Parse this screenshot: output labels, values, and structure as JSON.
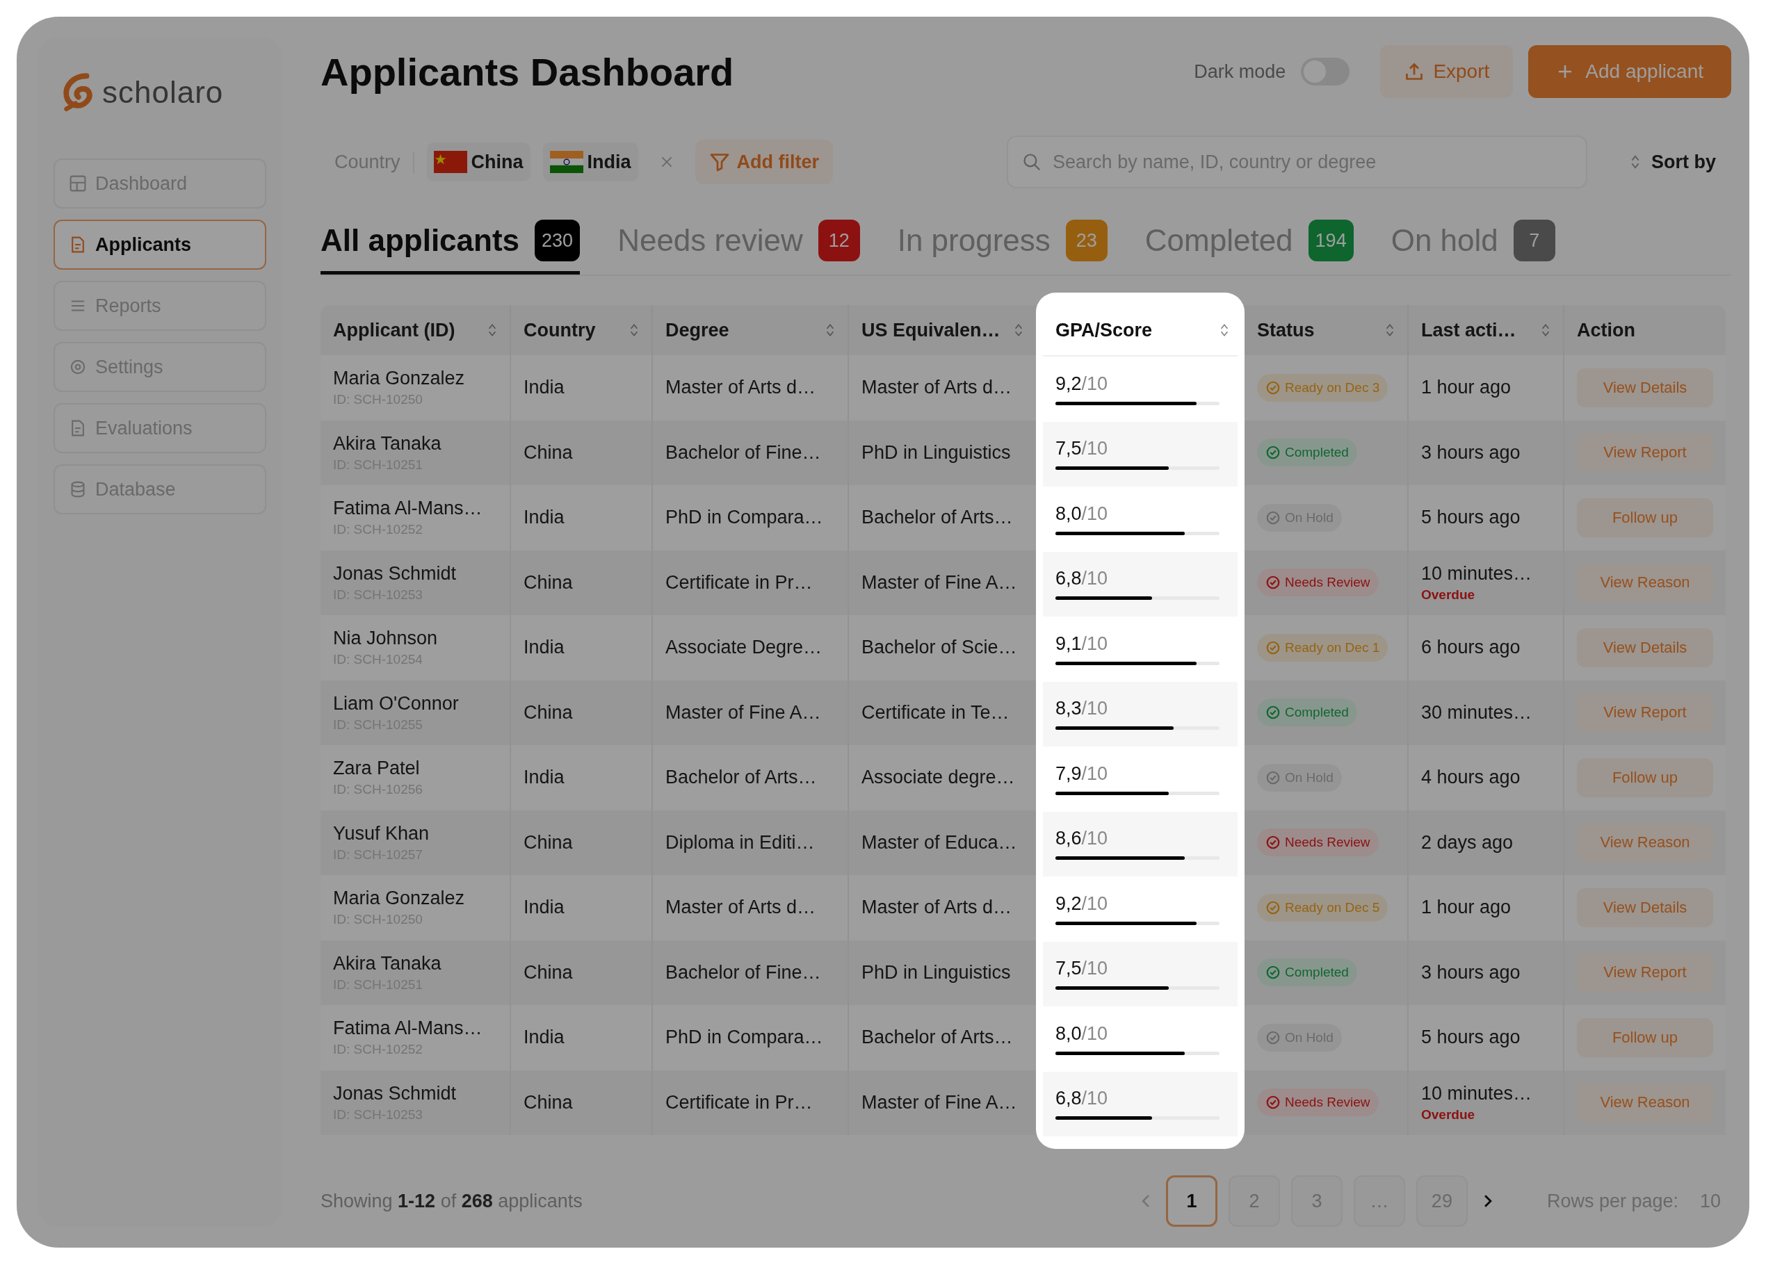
{
  "sidebar": {
    "logo": "scholaro",
    "items": [
      {
        "label": "Dashboard",
        "selected": false
      },
      {
        "label": "Applicants",
        "selected": true
      },
      {
        "label": "Reports",
        "selected": false
      },
      {
        "label": "Settings",
        "selected": false
      },
      {
        "label": "Evaluations",
        "selected": false
      },
      {
        "label": "Database",
        "selected": false
      }
    ]
  },
  "header": {
    "title": "Applicants Dashboard",
    "dark_mode": {
      "label": "Dark mode",
      "on": false
    },
    "export": "Export",
    "add": "Add applicant"
  },
  "filters": {
    "label": "Country",
    "chips": [
      {
        "label": "China",
        "kind": "cn"
      },
      {
        "label": "India",
        "kind": "in"
      }
    ],
    "add_filter": "Add filter",
    "search": {
      "placeholder": "Search by name, ID, country or degree"
    },
    "sort": "Sort by"
  },
  "tabs": [
    {
      "label": "All applicants",
      "count": "230",
      "kind": "all",
      "selected": true
    },
    {
      "label": "Needs review",
      "count": "12",
      "kind": "review",
      "selected": false
    },
    {
      "label": "In progress",
      "count": "23",
      "kind": "progress",
      "selected": false
    },
    {
      "label": "Completed",
      "count": "194",
      "kind": "completed",
      "selected": false
    },
    {
      "label": "On hold",
      "count": "7",
      "kind": "hold",
      "selected": false
    }
  ],
  "table": {
    "columns": [
      {
        "label": "Applicant (ID)",
        "sortable": true
      },
      {
        "label": "Country",
        "sortable": true
      },
      {
        "label": "Degree",
        "sortable": true
      },
      {
        "label": "US Equivalen…",
        "sortable": true
      },
      {
        "label": "GPA/Score",
        "sortable": true
      },
      {
        "label": "Status",
        "sortable": true
      },
      {
        "label": "Last acti…",
        "sortable": true
      },
      {
        "label": "Action",
        "sortable": false
      }
    ],
    "rows": [
      {
        "name": "Maria Gonzalez",
        "id": "ID: SCH-10250",
        "country": "India",
        "degree": "Master of Arts d…",
        "us_equivalent": "Master of Arts d…",
        "score": "9,2",
        "scale": "/10",
        "level": 0.86,
        "status": {
          "kind": "ready",
          "label": "Ready on Dec 3"
        },
        "last_action": "1 hour ago",
        "action": "View Details"
      },
      {
        "name": "Akira Tanaka",
        "id": "ID: SCH-10251",
        "country": "China",
        "degree": "Bachelor of Fine…",
        "us_equivalent": "PhD in Linguistics",
        "score": "7,5",
        "scale": "/10",
        "level": 0.69,
        "status": {
          "kind": "completed",
          "label": "Completed"
        },
        "last_action": "3 hours ago",
        "action": "View Report"
      },
      {
        "name": "Fatima Al-Mans…",
        "id": "ID: SCH-10252",
        "country": "India",
        "degree": "PhD in Compara…",
        "us_equivalent": "Bachelor of Arts…",
        "score": "8,0",
        "scale": "/10",
        "level": 0.79,
        "status": {
          "kind": "hold",
          "label": "On Hold"
        },
        "last_action": "5 hours ago",
        "action": "Follow up"
      },
      {
        "name": "Jonas Schmidt",
        "id": "ID: SCH-10253",
        "country": "China",
        "degree": "Certificate in Pr…",
        "us_equivalent": "Master of Fine A…",
        "score": "6,8",
        "scale": "/10",
        "level": 0.59,
        "status": {
          "kind": "review",
          "label": "Needs Review"
        },
        "last_action": "10 minutes…",
        "note": "Overdue",
        "action": "View Reason"
      },
      {
        "name": "Nia Johnson",
        "id": "ID: SCH-10254",
        "country": "India",
        "degree": "Associate Degre…",
        "us_equivalent": "Bachelor of Scie…",
        "score": "9,1",
        "scale": "/10",
        "level": 0.86,
        "status": {
          "kind": "ready",
          "label": "Ready on Dec 1"
        },
        "last_action": "6 hours ago",
        "action": "View Details"
      },
      {
        "name": "Liam O'Connor",
        "id": "ID: SCH-10255",
        "country": "China",
        "degree": "Master of Fine A…",
        "us_equivalent": "Certificate in Te…",
        "score": "8,3",
        "scale": "/10",
        "level": 0.72,
        "status": {
          "kind": "completed",
          "label": "Completed"
        },
        "last_action": "30 minutes…",
        "action": "View Report"
      },
      {
        "name": "Zara Patel",
        "id": "ID: SCH-10256",
        "country": "India",
        "degree": "Bachelor of Arts…",
        "us_equivalent": "Associate degre…",
        "score": "7,9",
        "scale": "/10",
        "level": 0.69,
        "status": {
          "kind": "hold",
          "label": "On Hold"
        },
        "last_action": "4 hours ago",
        "action": "Follow up"
      },
      {
        "name": "Yusuf Khan",
        "id": "ID: SCH-10257",
        "country": "China",
        "degree": "Diploma in Editi…",
        "us_equivalent": "Master of Educa…",
        "score": "8,6",
        "scale": "/10",
        "level": 0.79,
        "status": {
          "kind": "review",
          "label": "Needs Review"
        },
        "last_action": "2 days ago",
        "action": "View Reason"
      },
      {
        "name": "Maria Gonzalez",
        "id": "ID: SCH-10250",
        "country": "India",
        "degree": "Master of Arts d…",
        "us_equivalent": "Master of Arts d…",
        "score": "9,2",
        "scale": "/10",
        "level": 0.86,
        "status": {
          "kind": "ready",
          "label": "Ready on Dec 5"
        },
        "last_action": "1 hour ago",
        "action": "View Details"
      },
      {
        "name": "Akira Tanaka",
        "id": "ID: SCH-10251",
        "country": "China",
        "degree": "Bachelor of Fine…",
        "us_equivalent": "PhD in Linguistics",
        "score": "7,5",
        "scale": "/10",
        "level": 0.69,
        "status": {
          "kind": "completed",
          "label": "Completed"
        },
        "last_action": "3 hours ago",
        "action": "View Report"
      },
      {
        "name": "Fatima Al-Mans…",
        "id": "ID: SCH-10252",
        "country": "India",
        "degree": "PhD in Compara…",
        "us_equivalent": "Bachelor of Arts…",
        "score": "8,0",
        "scale": "/10",
        "level": 0.79,
        "status": {
          "kind": "hold",
          "label": "On Hold"
        },
        "last_action": "5 hours ago",
        "action": "Follow up"
      },
      {
        "name": "Jonas Schmidt",
        "id": "ID: SCH-10253",
        "country": "China",
        "degree": "Certificate in Pr…",
        "us_equivalent": "Master of Fine A…",
        "score": "6,8",
        "scale": "/10",
        "level": 0.59,
        "status": {
          "kind": "review",
          "label": "Needs Review"
        },
        "last_action": "10 minutes…",
        "note": "Overdue",
        "action": "View Reason"
      }
    ]
  },
  "pagination": {
    "summary": "Showing **1-12** of **268** applicants",
    "pages": [
      {
        "label": "1",
        "selected": true
      },
      {
        "label": "2",
        "selected": false
      },
      {
        "label": "3",
        "selected": false
      },
      {
        "label": "…",
        "selected": false
      },
      {
        "label": "29",
        "selected": false
      }
    ],
    "rows_label": "Rows per page:",
    "rows_value": "10"
  }
}
